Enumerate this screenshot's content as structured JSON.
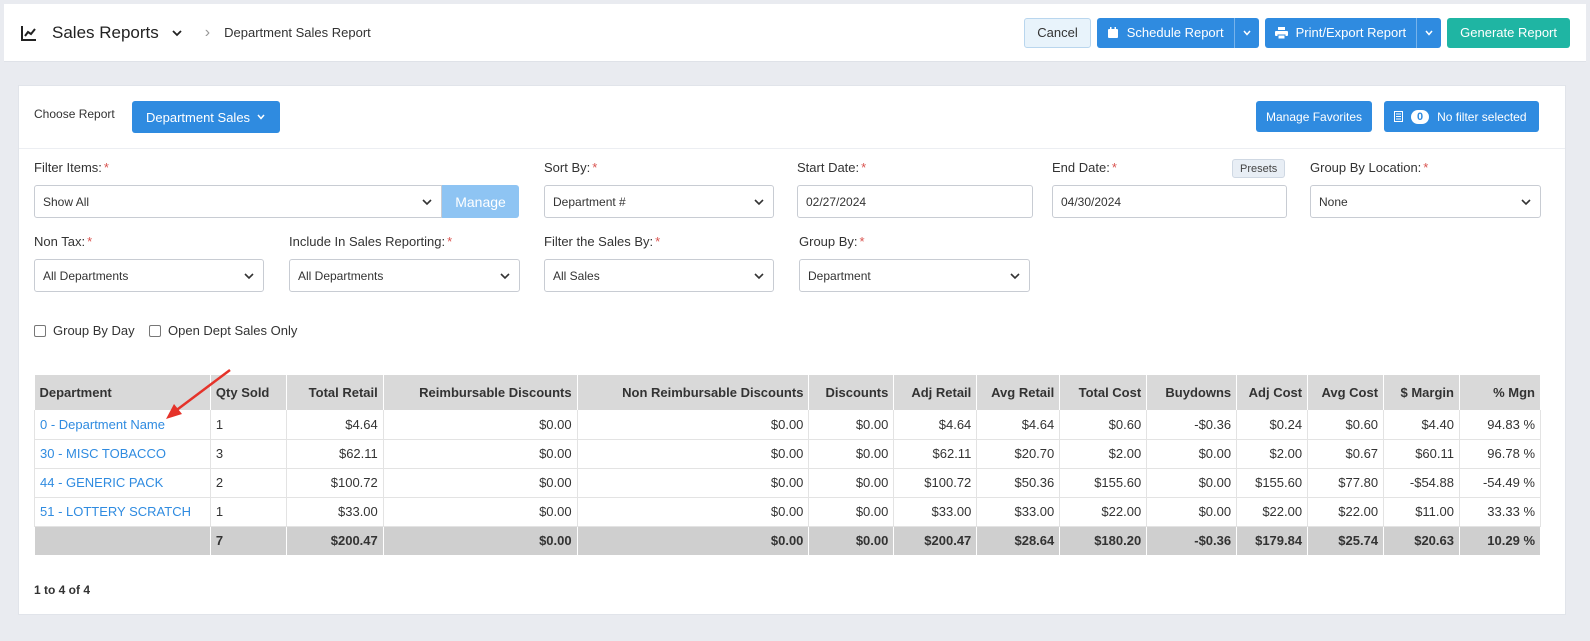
{
  "header": {
    "app_title": "Sales Reports",
    "breadcrumb": "Department Sales Report",
    "cancel_label": "Cancel",
    "schedule_label": "Schedule Report",
    "print_label": "Print/Export Report",
    "generate_label": "Generate Report"
  },
  "report_bar": {
    "choose_label": "Choose Report",
    "selected_report": "Department Sales",
    "favorites_label": "Manage Favorites",
    "filter_count": "0",
    "filter_label": "No filter selected"
  },
  "filters": {
    "filter_items": {
      "label": "Filter Items:",
      "value": "Show All",
      "manage_label": "Manage"
    },
    "sort_by": {
      "label": "Sort By:",
      "value": "Department #"
    },
    "start_date": {
      "label": "Start Date:",
      "value": "02/27/2024"
    },
    "end_date": {
      "label": "End Date:",
      "value": "04/30/2024",
      "presets_label": "Presets"
    },
    "group_by_location": {
      "label": "Group By Location:",
      "value": "None"
    },
    "non_tax": {
      "label": "Non Tax:",
      "value": "All Departments"
    },
    "include_in_sales": {
      "label": "Include In Sales Reporting:",
      "value": "All Departments"
    },
    "filter_sales_by": {
      "label": "Filter the Sales By:",
      "value": "All Sales"
    },
    "group_by": {
      "label": "Group By:",
      "value": "Department"
    },
    "required_mark": "*",
    "group_by_day": "Group By Day",
    "open_dept_only": "Open Dept Sales Only"
  },
  "table": {
    "columns": [
      "Department",
      "Qty Sold",
      "Total Retail",
      "Reimbursable Discounts",
      "Non Reimbursable Discounts",
      "Discounts",
      "Adj Retail",
      "Avg Retail",
      "Total Cost",
      "Buydowns",
      "Adj Cost",
      "Avg Cost",
      "$ Margin",
      "% Mgn"
    ],
    "rows": [
      [
        "0 - Department Name",
        "1",
        "$4.64",
        "$0.00",
        "$0.00",
        "$0.00",
        "$4.64",
        "$4.64",
        "$0.60",
        "-$0.36",
        "$0.24",
        "$0.60",
        "$4.40",
        "94.83 %"
      ],
      [
        "30 - MISC TOBACCO",
        "3",
        "$62.11",
        "$0.00",
        "$0.00",
        "$0.00",
        "$62.11",
        "$20.70",
        "$2.00",
        "$0.00",
        "$2.00",
        "$0.67",
        "$60.11",
        "96.78 %"
      ],
      [
        "44 - GENERIC PACK",
        "2",
        "$100.72",
        "$0.00",
        "$0.00",
        "$0.00",
        "$100.72",
        "$50.36",
        "$155.60",
        "$0.00",
        "$155.60",
        "$77.80",
        "-$54.88",
        "-54.49 %"
      ],
      [
        "51 - LOTTERY SCRATCH",
        "1",
        "$33.00",
        "$0.00",
        "$0.00",
        "$0.00",
        "$33.00",
        "$33.00",
        "$22.00",
        "$0.00",
        "$22.00",
        "$22.00",
        "$11.00",
        "33.33 %"
      ]
    ],
    "totals": [
      "",
      "7",
      "$200.47",
      "$0.00",
      "$0.00",
      "$0.00",
      "$200.47",
      "$28.64",
      "$180.20",
      "-$0.36",
      "$179.84",
      "$25.74",
      "$20.63",
      "10.29 %"
    ]
  },
  "pager": "1 to 4 of 4",
  "colors": {
    "primary": "#2f8be0",
    "teal": "#1fb5a3",
    "annotation": "#e5332a"
  }
}
